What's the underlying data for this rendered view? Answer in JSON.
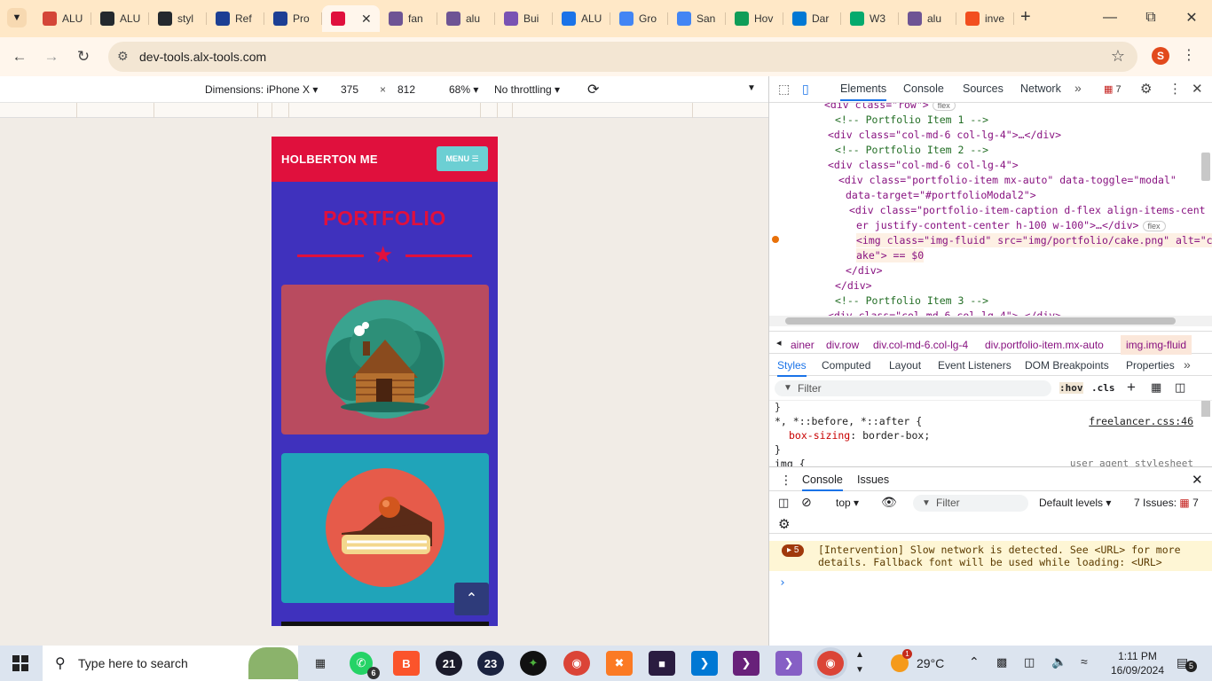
{
  "browser": {
    "tabs": [
      {
        "label": "ALU",
        "icon": "gmail-icon",
        "color": "#d44638"
      },
      {
        "label": "ALU",
        "icon": "github-icon",
        "color": "#24292e"
      },
      {
        "label": "styl",
        "icon": "github-icon",
        "color": "#24292e"
      },
      {
        "label": "Ref",
        "icon": "doc-icon",
        "color": "#1c3f94"
      },
      {
        "label": "Pro",
        "icon": "doc-icon",
        "color": "#1c3f94"
      },
      {
        "label": "",
        "icon": "holberton-icon",
        "color": "#e0103d",
        "active": true
      },
      {
        "label": "fan",
        "icon": "github-icon",
        "color": "#6e5494"
      },
      {
        "label": "alu",
        "icon": "github-icon",
        "color": "#6e5494"
      },
      {
        "label": "Bui",
        "icon": "bootstrap-icon",
        "color": "#7952b3"
      },
      {
        "label": "ALU",
        "icon": "calendar-icon",
        "color": "#1a73e8"
      },
      {
        "label": "Gro",
        "icon": "docs-icon",
        "color": "#4285f4"
      },
      {
        "label": "San",
        "icon": "docs-icon",
        "color": "#4285f4"
      },
      {
        "label": "Hov",
        "icon": "drive-icon",
        "color": "#0f9d58"
      },
      {
        "label": "Dar",
        "icon": "edge-icon",
        "color": "#0078d4"
      },
      {
        "label": "W3",
        "icon": "w3-icon",
        "color": "#04aa6d"
      },
      {
        "label": "alu",
        "icon": "github-icon",
        "color": "#6e5494"
      },
      {
        "label": "inve",
        "icon": "figma-icon",
        "color": "#f24e1e"
      }
    ],
    "url": "dev-tools.alx-tools.com",
    "profile_initial": "S"
  },
  "device_toolbar": {
    "dimensions_label": "Dimensions: iPhone X",
    "width": "375",
    "height": "812",
    "times": "×",
    "zoom": "68%",
    "throttling": "No throttling"
  },
  "page": {
    "brand": "HOLBERTON ME",
    "menu_label": "MENU",
    "section_title": "PORTFOLIO",
    "cards": [
      {
        "alt": "cabin",
        "bg": "#b94b5f"
      },
      {
        "alt": "cake",
        "bg": "#20a4b9"
      }
    ]
  },
  "devtools": {
    "tabs": [
      "Elements",
      "Console",
      "Sources",
      "Network"
    ],
    "issues_badge": "7",
    "elements_lines": [
      {
        "t": "<div class=\"row\">",
        "badge": "flex"
      },
      {
        "t": "<!-- Portfolio Item 1 -->"
      },
      {
        "t": "<div class=\"col-md-6 col-lg-4\">…</div>"
      },
      {
        "t": "<!-- Portfolio Item 2 -->"
      },
      {
        "t": "<div class=\"col-md-6 col-lg-4\">"
      },
      {
        "t": "<div class=\"portfolio-item mx-auto\" data-toggle=\"modal\""
      },
      {
        "t": "data-target=\"#portfolioModal2\">"
      },
      {
        "t": "<div class=\"portfolio-item-caption d-flex align-items-cent"
      },
      {
        "t": "er justify-content-center h-100 w-100\">…</div>",
        "badge": "flex"
      },
      {
        "t": "<img class=\"img-fluid\" src=\"img/portfolio/cake.png\" alt=\"c"
      },
      {
        "t": "ake\"> == $0"
      },
      {
        "t": "</div>"
      },
      {
        "t": "</div>"
      },
      {
        "t": "<!-- Portfolio Item 3 -->"
      },
      {
        "t": "<div class=\"col-md-6 col-lg-4\">…</div>"
      }
    ],
    "breadcrumbs": [
      "ainer",
      "div.row",
      "div.col-md-6.col-lg-4",
      "div.portfolio-item.mx-auto",
      "img.img-fluid"
    ],
    "style_tabs": [
      "Styles",
      "Computed",
      "Layout",
      "Event Listeners",
      "DOM Breakpoints",
      "Properties"
    ],
    "filter_placeholder": "Filter",
    "hov": ":hov",
    "cls": ".cls",
    "rule_selector": "*, *::before, *::after {",
    "rule_source": "freelancer.css:46",
    "rule_prop": "box-sizing",
    "rule_val": "border-box;",
    "rule_close": "}",
    "rule_next": "img {",
    "rule_next_source": "user agent stylesheet",
    "drawer_tabs": [
      "Console",
      "Issues"
    ],
    "context": "top",
    "console_filter": "Filter",
    "levels": "Default levels",
    "issues_count": "7 Issues:",
    "issues_num": "7",
    "message_count": "5",
    "message": "[Intervention] Slow network is detected. See <URL> for more details. Fallback font will be used while loading: <URL>",
    "prompt": "›"
  },
  "taskbar": {
    "search_placeholder": "Type here to search",
    "whatsapp_badge": "6",
    "app21": "21",
    "app23": "23",
    "weather": "29°C",
    "weather_badge": "1",
    "time": "1:11 PM",
    "date": "16/09/2024",
    "notif_count": "5"
  }
}
